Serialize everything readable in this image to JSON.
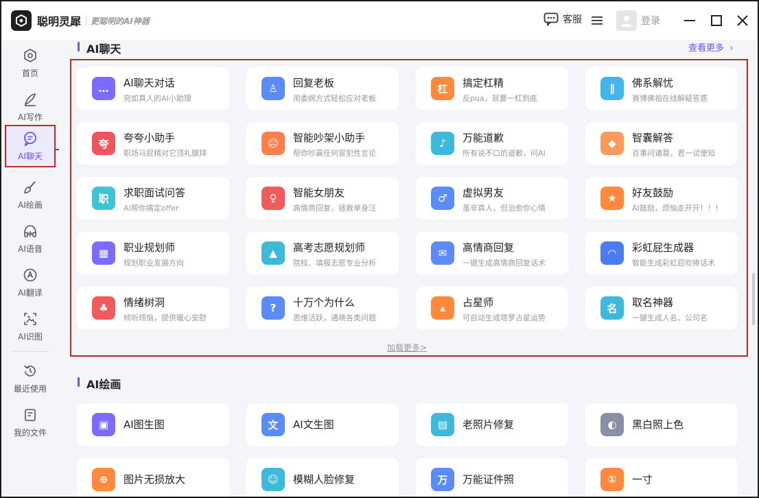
{
  "app": {
    "name": "聪明灵犀",
    "slogan": "更聪明的AI神器"
  },
  "header": {
    "service_label": "客服",
    "login_label": "登录"
  },
  "sidebar": {
    "items": [
      {
        "label": "首页",
        "icon": "home-icon"
      },
      {
        "label": "AI写作",
        "icon": "pen-icon"
      },
      {
        "label": "AI聊天",
        "icon": "chat-icon",
        "active": true
      },
      {
        "label": "AI绘画",
        "icon": "brush-icon"
      },
      {
        "label": "AI语音",
        "icon": "headphones-icon"
      },
      {
        "label": "AI翻译",
        "icon": "translate-icon"
      },
      {
        "label": "AI识图",
        "icon": "image-scan-icon"
      },
      {
        "label": "最近使用",
        "icon": "history-icon"
      },
      {
        "label": "我的文件",
        "icon": "file-icon"
      }
    ]
  },
  "chat_section": {
    "title": "AI聊天",
    "more_label": "查看更多",
    "load_more_label": "加载更多>",
    "cards": [
      {
        "title": "AI聊天对话",
        "desc": "宛如真人的AI小助理",
        "icon": "chat-bubble-icon",
        "color": "#7b6cff"
      },
      {
        "title": "回复老板",
        "desc": "用委婉方式轻松应对老板",
        "icon": "boss-icon",
        "color": "#5b8cf5"
      },
      {
        "title": "搞定杠精",
        "desc": "反pua，就要一杠到底",
        "icon": "bar-icon",
        "color": "#ff8a3d"
      },
      {
        "title": "佛系解忧",
        "desc": "赛博佛祖在线解疑答惑",
        "icon": "buddha-icon",
        "color": "#3fb7e8"
      },
      {
        "title": "夸夸小助手",
        "desc": "职场马屁精对它顶礼膜拜",
        "icon": "praise-icon",
        "color": "#f0555e"
      },
      {
        "title": "智能吵架小助手",
        "desc": "帮你吵赢任何冒犯性言论",
        "icon": "angry-face-icon",
        "color": "#ff7e4a"
      },
      {
        "title": "万能道歉",
        "desc": "所有说不口的道歉，问AI",
        "icon": "apology-icon",
        "color": "#3fb9d9"
      },
      {
        "title": "智囊解答",
        "desc": "百事问诸葛，君一试便知",
        "icon": "bag-icon",
        "color": "#ff9a5a"
      },
      {
        "title": "求职面试问答",
        "desc": "AI帮你搞定offer",
        "icon": "job-icon",
        "color": "#3fc4d6"
      },
      {
        "title": "智能女朋友",
        "desc": "高情商回复，拯救单身汪",
        "icon": "girlfriend-icon",
        "color": "#f15b5b"
      },
      {
        "title": "虚拟男友",
        "desc": "虽非真人，但治愈你心情",
        "icon": "boyfriend-icon",
        "color": "#5b8cf5"
      },
      {
        "title": "好友鼓励",
        "desc": "AI鼓励，烦恼走开开！！！",
        "icon": "thumbs-up-icon",
        "color": "#ff8a3d"
      },
      {
        "title": "职业规划师",
        "desc": "规划职业发展方向",
        "icon": "calendar-icon",
        "color": "#7b6cff"
      },
      {
        "title": "高考志愿规划师",
        "desc": "院校、填报志愿专业分析",
        "icon": "graduation-cap-icon",
        "color": "#3fb9d9"
      },
      {
        "title": "高情商回复",
        "desc": "一键生成高情商回复话术",
        "icon": "message-icon",
        "color": "#5b8cf5"
      },
      {
        "title": "彩虹屁生成器",
        "desc": "智能生成彩虹屁吹捧话术",
        "icon": "rainbow-icon",
        "color": "#4a7cf0"
      },
      {
        "title": "情绪树洞",
        "desc": "倾听烦恼，提供暖心安慰",
        "icon": "tree-icon",
        "color": "#f15b5b"
      },
      {
        "title": "十万个为什么",
        "desc": "思维活跃，通晓各类问题",
        "icon": "question-head-icon",
        "color": "#5b8cf5"
      },
      {
        "title": "占星师",
        "desc": "可自动生成塔罗占星运势",
        "icon": "wizard-hat-icon",
        "color": "#ff8a3d"
      },
      {
        "title": "取名神器",
        "desc": "一键生成人名、公司名",
        "icon": "name-icon",
        "color": "#3fb9d9"
      }
    ]
  },
  "paint_section": {
    "title": "AI绘画",
    "cards": [
      {
        "title": "AI图生图",
        "icon": "image-to-image-icon",
        "color": "#7b6cff"
      },
      {
        "title": "AI文生图",
        "icon": "text-to-image-icon",
        "color": "#5b8cf5"
      },
      {
        "title": "老照片修复",
        "icon": "photo-restore-icon",
        "color": "#3fb9d9"
      },
      {
        "title": "黑白照上色",
        "icon": "colorize-icon",
        "color": "#8a8fa8"
      },
      {
        "title": "图片无损放大",
        "icon": "upscale-icon",
        "color": "#ff8a3d"
      },
      {
        "title": "模糊人脸修复",
        "icon": "face-restore-icon",
        "color": "#3fb9d9"
      },
      {
        "title": "万能证件照",
        "icon": "id-photo-icon",
        "color": "#5b8cf5"
      },
      {
        "title": "一寸",
        "icon": "one-inch-photo-icon",
        "color": "#ff8a3d"
      }
    ]
  }
}
